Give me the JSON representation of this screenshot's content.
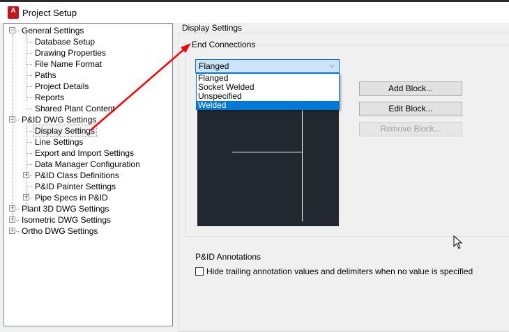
{
  "window": {
    "title": "Project Setup",
    "app_icon": "A"
  },
  "tree": [
    {
      "label": "General Settings",
      "level": 0,
      "expander": "minus"
    },
    {
      "label": "Database Setup",
      "level": 1
    },
    {
      "label": "Drawing Properties",
      "level": 1
    },
    {
      "label": "File Name Format",
      "level": 1
    },
    {
      "label": "Paths",
      "level": 1
    },
    {
      "label": "Project Details",
      "level": 1
    },
    {
      "label": "Reports",
      "level": 1
    },
    {
      "label": "Shared Plant Content",
      "level": 1
    },
    {
      "label": "P&ID DWG Settings",
      "level": 0,
      "expander": "minus"
    },
    {
      "label": "Display Settings",
      "level": 1,
      "selected": true
    },
    {
      "label": "Line Settings",
      "level": 1
    },
    {
      "label": "Export and Import Settings",
      "level": 1
    },
    {
      "label": "Data Manager Configuration",
      "level": 1
    },
    {
      "label": "P&ID Class Definitions",
      "level": 1,
      "expander": "plus"
    },
    {
      "label": "P&ID Painter Settings",
      "level": 1
    },
    {
      "label": "Pipe Specs in P&ID",
      "level": 1,
      "expander": "plus"
    },
    {
      "label": "Plant 3D DWG Settings",
      "level": 0,
      "expander": "plus"
    },
    {
      "label": "Isometric DWG Settings",
      "level": 0,
      "expander": "plus"
    },
    {
      "label": "Ortho DWG Settings",
      "level": 0,
      "expander": "plus"
    }
  ],
  "panel": {
    "group_title": "Display Settings",
    "end_connections": {
      "title": "End Connections",
      "combo_value": "Flanged",
      "options": [
        "Flanged",
        "Socket Welded",
        "Unspecified",
        "Welded"
      ],
      "highlighted": "Welded"
    },
    "buttons": {
      "add": "Add Block...",
      "edit": "Edit Block...",
      "remove": "Remove Block..."
    },
    "annotations": {
      "title": "P&ID Annotations",
      "checkbox_label": "Hide trailing annotation values and delimiters when no value is specified",
      "checked": false
    }
  },
  "colors": {
    "accent": "#0078d7",
    "arrow": "#ff0000",
    "preview_bg": "#232830"
  }
}
